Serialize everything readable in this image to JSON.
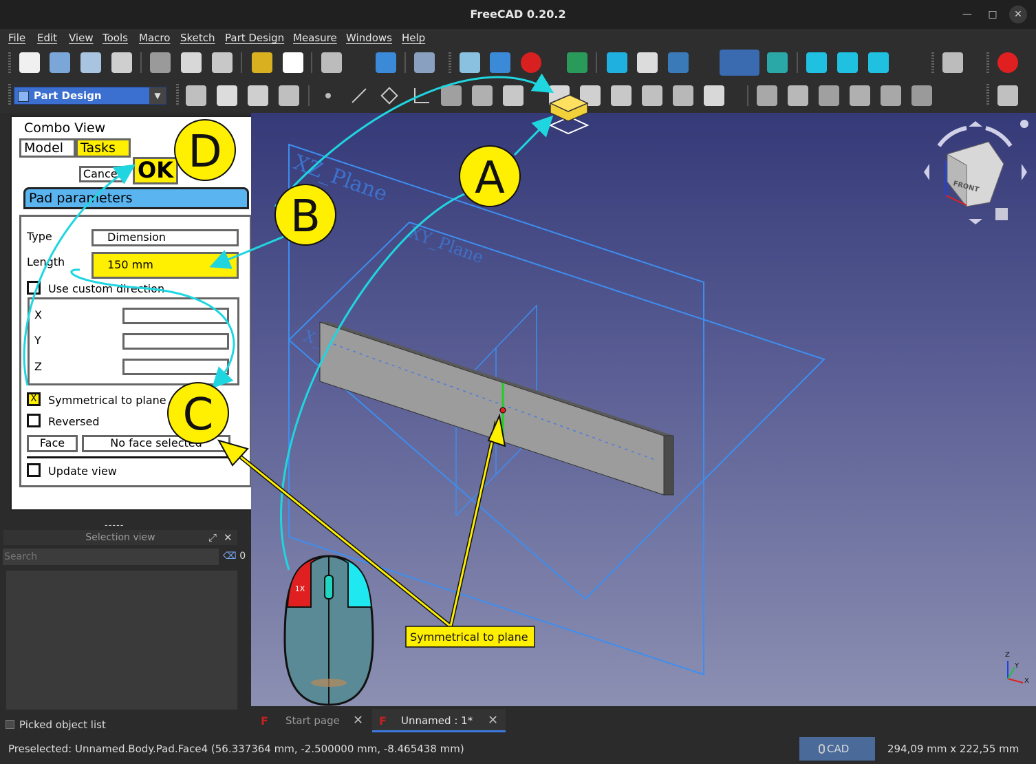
{
  "window": {
    "title": "FreeCAD 0.20.2"
  },
  "menu": [
    "File",
    "Edit",
    "View",
    "Tools",
    "Macro",
    "Sketch",
    "Part Design",
    "Measure",
    "Windows",
    "Help"
  ],
  "workbench": {
    "selected": "Part Design"
  },
  "combo_view": {
    "title": "Combo View",
    "tabs": {
      "model": "Model",
      "tasks": "Tasks"
    },
    "cancel_label": "Cancel",
    "ok_label": "OK",
    "panel_title": "Pad parameters",
    "type_label": "Type",
    "type_value": "Dimension",
    "length_label": "Length",
    "length_value": "150 mm",
    "custom_direction_label": "Use custom direction",
    "x_label": "X",
    "y_label": "Y",
    "z_label": "Z",
    "symmetrical_label": "Symmetrical to plane",
    "symmetrical_mark": "X",
    "reversed_label": "Reversed",
    "face_button": "Face",
    "face_value": "No face selected",
    "update_view_label": "Update view"
  },
  "selection_view": {
    "handle": "-----",
    "title": "Selection view",
    "search_placeholder": "Search",
    "count": "0",
    "picked_label": "Picked object list"
  },
  "viewport": {
    "plane_xz": "XZ_Plane",
    "plane_xy": "XY_Plane",
    "axis_x": "X_Axis",
    "cube_face": "FRONT",
    "axis_z": "Z",
    "axis_y": "Y",
    "axis_xx": "X"
  },
  "annotations": {
    "a": "A",
    "b": "B",
    "c": "C",
    "d": "D",
    "mouse_click": "1X",
    "tooltip": "Symmetrical to plane"
  },
  "tabs": [
    {
      "label": "Start page",
      "active": false
    },
    {
      "label": "Unnamed : 1*",
      "active": true
    }
  ],
  "status": {
    "preselected": "Preselected: Unnamed.Body.Pad.Face4 (56.337364 mm, -2.500000 mm, -8.465438 mm)",
    "nav_style": "CAD",
    "dimensions": "294,09 mm x 222,55 mm"
  },
  "colors": {
    "highlight_yellow": "#ffef00",
    "arrow_cyan": "#1fd6e0",
    "panel_blue": "#5ab4f0",
    "record_red": "#e02020"
  }
}
